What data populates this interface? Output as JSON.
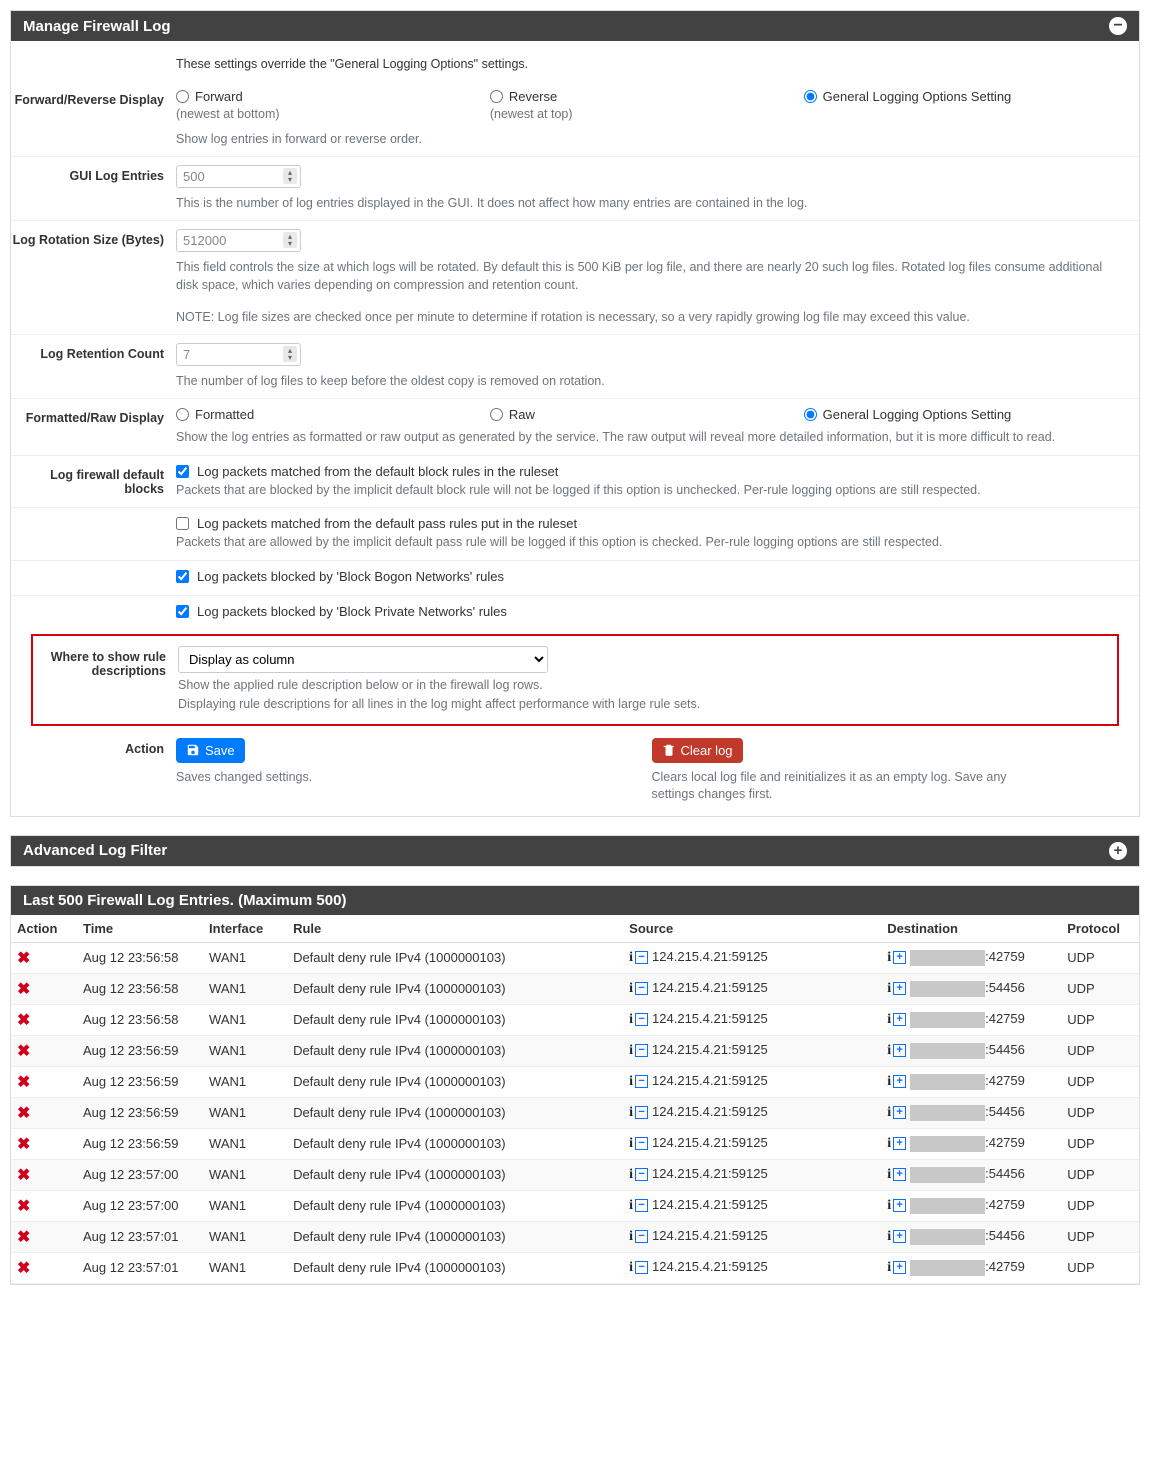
{
  "panels": {
    "manage": "Manage Firewall Log",
    "filter": "Advanced Log Filter",
    "entries": "Last 500 Firewall Log Entries. (Maximum 500)"
  },
  "intro": "These settings override the \"General Logging Options\" settings.",
  "labels": {
    "fwdrev": "Forward/Reverse Display",
    "guientries": "GUI Log Entries",
    "rotsize": "Log Rotation Size (Bytes)",
    "retention": "Log Retention Count",
    "fmtraw": "Formatted/Raw Display",
    "defblocks": "Log firewall default blocks",
    "ruledesc": "Where to show rule descriptions",
    "action": "Action"
  },
  "fwdrev": {
    "opts": [
      "Forward",
      "Reverse",
      "General Logging Options Setting"
    ],
    "subs": [
      "(newest at bottom)",
      "(newest at top)"
    ],
    "hint": "Show log entries in forward or reverse order."
  },
  "guientries": {
    "value": "500",
    "hint": "This is the number of log entries displayed in the GUI. It does not affect how many entries are contained in the log."
  },
  "rotsize": {
    "value": "512000",
    "hint1": "This field controls the size at which logs will be rotated. By default this is 500 KiB per log file, and there are nearly 20 such log files. Rotated log files consume additional disk space, which varies depending on compression and retention count.",
    "hint2": "NOTE: Log file sizes are checked once per minute to determine if rotation is necessary, so a very rapidly growing log file may exceed this value."
  },
  "retention": {
    "value": "7",
    "hint": "The number of log files to keep before the oldest copy is removed on rotation."
  },
  "fmtraw": {
    "opts": [
      "Formatted",
      "Raw",
      "General Logging Options Setting"
    ],
    "hint": "Show the log entries as formatted or raw output as generated by the service. The raw output will reveal more detailed information, but it is more difficult to read."
  },
  "checks": {
    "c1": {
      "label": "Log packets matched from the default block rules in the ruleset",
      "hint": "Packets that are blocked by the implicit default block rule will not be logged if this option is unchecked. Per-rule logging options are still respected."
    },
    "c2": {
      "label": "Log packets matched from the default pass rules put in the ruleset",
      "hint": "Packets that are allowed by the implicit default pass rule will be logged if this option is checked. Per-rule logging options are still respected."
    },
    "c3": {
      "label": "Log packets blocked by 'Block Bogon Networks' rules"
    },
    "c4": {
      "label": "Log packets blocked by 'Block Private Networks' rules"
    }
  },
  "ruledesc": {
    "selected": "Display as column",
    "hint1": "Show the applied rule description below or in the firewall log rows.",
    "hint2": "Displaying rule descriptions for all lines in the log might affect performance with large rule sets."
  },
  "actions": {
    "save": "Save",
    "save_hint": "Saves changed settings.",
    "clear": "Clear log",
    "clear_hint": "Clears local log file and reinitializes it as an empty log. Save any settings changes first."
  },
  "table": {
    "headers": [
      "Action",
      "Time",
      "Interface",
      "Rule",
      "Source",
      "Destination",
      "Protocol"
    ],
    "rows": [
      {
        "time": "Aug 12 23:56:58",
        "iface": "WAN1",
        "rule": "Default deny rule IPv4 (1000000103)",
        "src": "124.215.4.21:59125",
        "dport": ":42759",
        "proto": "UDP"
      },
      {
        "time": "Aug 12 23:56:58",
        "iface": "WAN1",
        "rule": "Default deny rule IPv4 (1000000103)",
        "src": "124.215.4.21:59125",
        "dport": ":54456",
        "proto": "UDP"
      },
      {
        "time": "Aug 12 23:56:58",
        "iface": "WAN1",
        "rule": "Default deny rule IPv4 (1000000103)",
        "src": "124.215.4.21:59125",
        "dport": ":42759",
        "proto": "UDP"
      },
      {
        "time": "Aug 12 23:56:59",
        "iface": "WAN1",
        "rule": "Default deny rule IPv4 (1000000103)",
        "src": "124.215.4.21:59125",
        "dport": ":54456",
        "proto": "UDP"
      },
      {
        "time": "Aug 12 23:56:59",
        "iface": "WAN1",
        "rule": "Default deny rule IPv4 (1000000103)",
        "src": "124.215.4.21:59125",
        "dport": ":42759",
        "proto": "UDP"
      },
      {
        "time": "Aug 12 23:56:59",
        "iface": "WAN1",
        "rule": "Default deny rule IPv4 (1000000103)",
        "src": "124.215.4.21:59125",
        "dport": ":54456",
        "proto": "UDP"
      },
      {
        "time": "Aug 12 23:56:59",
        "iface": "WAN1",
        "rule": "Default deny rule IPv4 (1000000103)",
        "src": "124.215.4.21:59125",
        "dport": ":42759",
        "proto": "UDP"
      },
      {
        "time": "Aug 12 23:57:00",
        "iface": "WAN1",
        "rule": "Default deny rule IPv4 (1000000103)",
        "src": "124.215.4.21:59125",
        "dport": ":54456",
        "proto": "UDP"
      },
      {
        "time": "Aug 12 23:57:00",
        "iface": "WAN1",
        "rule": "Default deny rule IPv4 (1000000103)",
        "src": "124.215.4.21:59125",
        "dport": ":42759",
        "proto": "UDP"
      },
      {
        "time": "Aug 12 23:57:01",
        "iface": "WAN1",
        "rule": "Default deny rule IPv4 (1000000103)",
        "src": "124.215.4.21:59125",
        "dport": ":54456",
        "proto": "UDP"
      },
      {
        "time": "Aug 12 23:57:01",
        "iface": "WAN1",
        "rule": "Default deny rule IPv4 (1000000103)",
        "src": "124.215.4.21:59125",
        "dport": ":42759",
        "proto": "UDP"
      }
    ]
  }
}
